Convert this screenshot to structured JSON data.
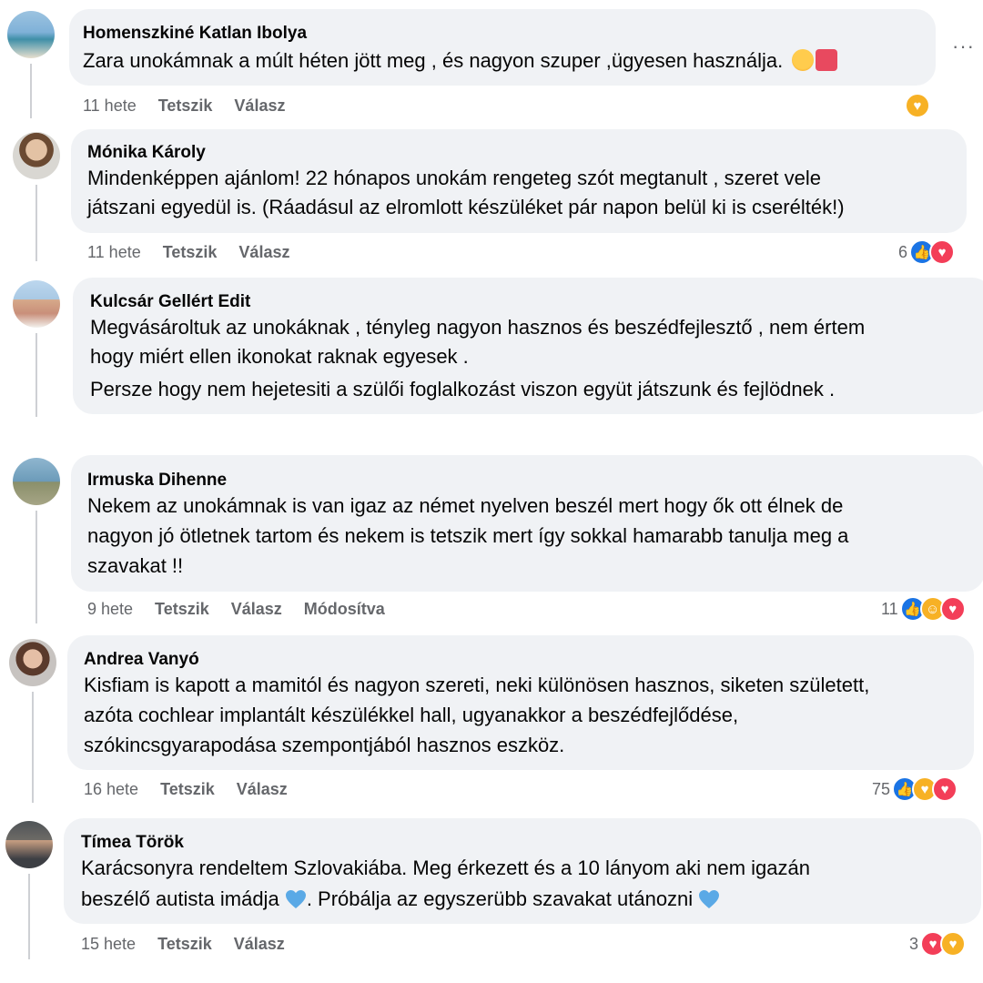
{
  "comments": [
    {
      "author": "Homenszkiné Katlan Ibolya",
      "lines": [
        "Zara unokámnak a múlt héten jött meg , és nagyon szuper ,ügyesen használja."
      ],
      "time": "11 hete",
      "like": "Tetszik",
      "reply": "Válasz",
      "count": ""
    },
    {
      "author": "Mónika Károly",
      "lines": [
        "Mindenképpen ajánlom! 22 hónapos unokám rengeteg szót megtanult , szeret vele",
        "játszani egyedül is. (Ráadásul az elromlott készüléket pár napon belül ki is cserélték!)"
      ],
      "time": "11 hete",
      "like": "Tetszik",
      "reply": "Válasz",
      "count": "6"
    },
    {
      "author": "Kulcsár Gellért Edit",
      "lines": [
        "Megvásároltuk az unokáknak , tényleg nagyon hasznos és beszédfejlesztő , nem értem",
        "hogy miért ellen ikonokat raknak egyesek .",
        "Persze hogy nem hejetesiti a szülői foglalkozást viszon együt játszunk és fejlödnek ."
      ]
    },
    {
      "author": "Irmuska Dihenne",
      "lines": [
        "Nekem az unokámnak is van igaz az német nyelven beszél mert hogy ők ott élnek de",
        "nagyon jó ötletnek tartom és nekem is tetszik mert így sokkal hamarabb tanulja meg a",
        "szavakat !!"
      ],
      "time": "9 hete",
      "like": "Tetszik",
      "reply": "Válasz",
      "edited": "Módosítva",
      "count": "11"
    },
    {
      "author": "Andrea Vanyó",
      "lines": [
        "Kisfiam is kapott a mamitól és nagyon szereti, neki különösen hasznos, siketen született,",
        "azóta cochlear implantált készülékkel hall, ugyanakkor a beszédfejlődése,",
        "szókincsgyarapodása szempontjából hasznos eszköz."
      ],
      "time": "16 hete",
      "like": "Tetszik",
      "reply": "Válasz",
      "count": "75"
    },
    {
      "author": "Tímea Török",
      "line1_a": "Karácsonyra rendeltem Szlovakiába. Meg érkezett és a 10 lányom aki nem igazán",
      "line2_a": "beszélő autista imádja",
      "line2_b": ". Próbálja az egyszerübb szavakat utánozni",
      "time": "15 hete",
      "like": "Tetszik",
      "reply": "Válasz",
      "count": "3"
    }
  ],
  "colors": {
    "bubble": "#f0f2f5",
    "meta": "#65676b",
    "like": "#1b74e4",
    "love": "#f33e58",
    "care": "#f7b125"
  },
  "icons": [
    "more-options-icon",
    "like-reaction-icon",
    "love-reaction-icon",
    "care-reaction-icon",
    "haha-reaction-icon",
    "blue-heart-emoji"
  ]
}
